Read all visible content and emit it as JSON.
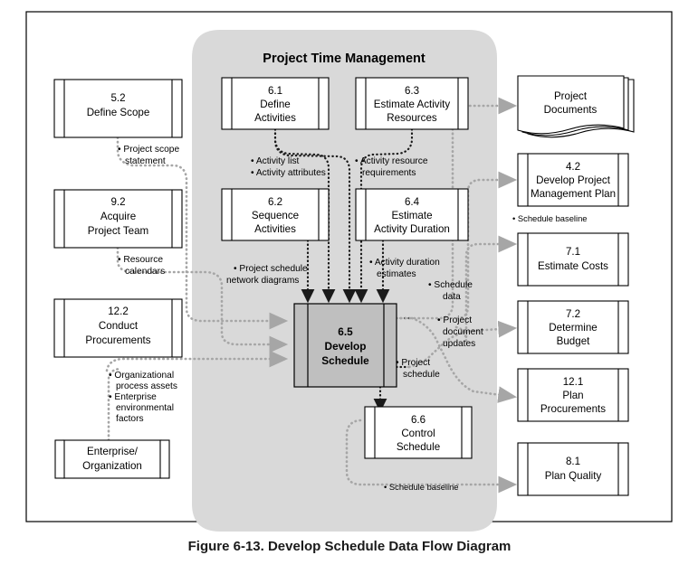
{
  "figure": {
    "caption": "Figure 6-13. Develop Schedule Data Flow Diagram",
    "frame_color": "#000000",
    "group_fill": "#d9d9d9",
    "focus_fill": "#bfbfbf",
    "connector_color": "#a6a6a6",
    "arrow_dark": "#1a1a1a"
  },
  "knowledge_area": {
    "title": "Project Time Management"
  },
  "processes": {
    "define_activities": {
      "number": "6.1",
      "line1": "Define",
      "line2": "Activities"
    },
    "estimate_activity_resources": {
      "number": "6.3",
      "line1": "Estimate Activity",
      "line2": "Resources"
    },
    "sequence_activities": {
      "number": "6.2",
      "line1": "Sequence",
      "line2": "Activities"
    },
    "estimate_activity_duration": {
      "number": "6.4",
      "line1": "Estimate",
      "line2": "Activity Duration"
    },
    "develop_schedule": {
      "number": "6.5",
      "line1": "Develop",
      "line2": "Schedule"
    },
    "control_schedule": {
      "number": "6.6",
      "line1": "Control",
      "line2": "Schedule"
    }
  },
  "external_inputs": {
    "define_scope": {
      "number": "5.2",
      "line1": "Define Scope",
      "line2": ""
    },
    "acquire_project_team": {
      "number": "9.2",
      "line1": "Acquire",
      "line2": "Project Team"
    },
    "conduct_procurements": {
      "number": "12.2",
      "line1": "Conduct",
      "line2": "Procurements"
    },
    "enterprise_organization": {
      "line1": "Enterprise/",
      "line2": "Organization"
    }
  },
  "external_outputs": {
    "project_documents": {
      "line1": "Project",
      "line2": "Documents"
    },
    "develop_project_management_plan": {
      "number": "4.2",
      "line1": "Develop Project",
      "line2": "Management Plan"
    },
    "estimate_costs": {
      "number": "7.1",
      "line1": "Estimate Costs",
      "line2": ""
    },
    "determine_budget": {
      "number": "7.2",
      "line1": "Determine",
      "line2": "Budget"
    },
    "plan_procurements": {
      "number": "12.1",
      "line1": "Plan",
      "line2": "Procurements"
    },
    "plan_quality": {
      "number": "8.1",
      "line1": "Plan Quality",
      "line2": ""
    }
  },
  "flow_labels": {
    "project_scope_statement": {
      "l1": "• Project scope",
      "l2": "statement"
    },
    "resource_calendars": {
      "l1": "• Resource",
      "l2": "calendars"
    },
    "org_process_assets": {
      "l1": "• Organizational",
      "l2": "process assets",
      "l3": "• Enterprise",
      "l4": "environmental",
      "l5": "factors"
    },
    "activity_list": {
      "l1": "• Activity list",
      "l2": "• Activity attributes"
    },
    "activity_resource_requirements": {
      "l1": "• Activity resource",
      "l2": "requirements"
    },
    "project_schedule_network_diagrams": {
      "l1": "• Project schedule",
      "l2": "network diagrams"
    },
    "activity_duration_estimates": {
      "l1": "• Activity duration",
      "l2": "estimates"
    },
    "schedule_data": {
      "l1": "• Schedule",
      "l2": "data"
    },
    "project_document_updates": {
      "l1": "• Project",
      "l2": "document",
      "l3": "updates"
    },
    "project_schedule": {
      "l1": "• Project",
      "l2": "schedule"
    },
    "schedule_baseline_right": {
      "l1": "• Schedule baseline"
    },
    "schedule_baseline_bottom": {
      "l1": "• Schedule baseline"
    }
  }
}
